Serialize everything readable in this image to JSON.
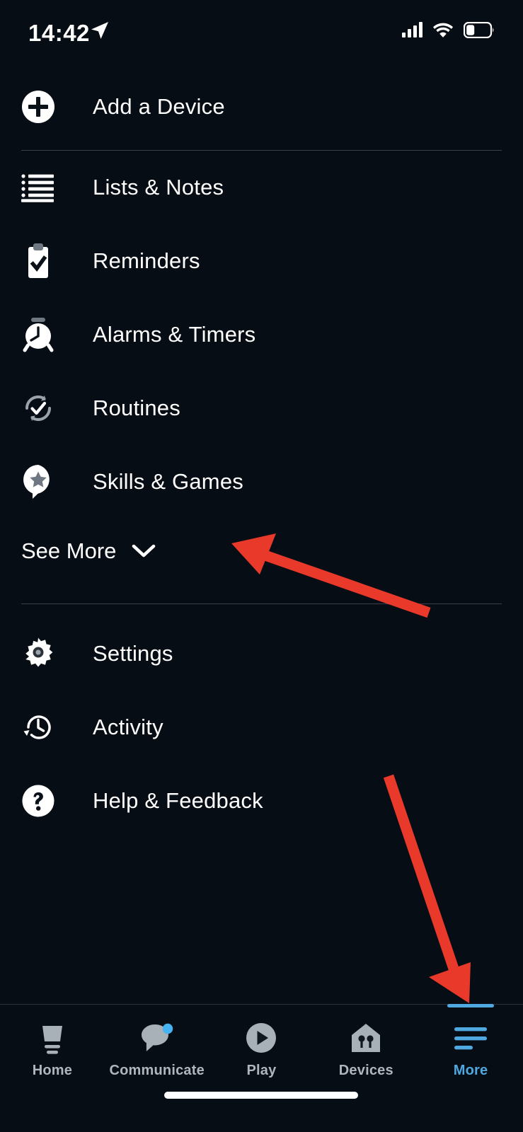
{
  "status_bar": {
    "time": "14:42",
    "location_icon": "location-arrow-icon",
    "signal_icon": "cellular-signal-icon",
    "wifi_icon": "wifi-icon",
    "battery_icon": "battery-low-icon"
  },
  "menu": {
    "add_device": {
      "label": "Add a Device",
      "icon": "plus-circle-icon"
    },
    "items": [
      {
        "label": "Lists & Notes",
        "icon": "list-icon"
      },
      {
        "label": "Reminders",
        "icon": "clipboard-check-icon"
      },
      {
        "label": "Alarms & Timers",
        "icon": "alarm-clock-icon"
      },
      {
        "label": "Routines",
        "icon": "routine-refresh-check-icon"
      },
      {
        "label": "Skills & Games",
        "icon": "star-bubble-icon"
      }
    ],
    "see_more": {
      "label": "See More",
      "icon": "chevron-down-icon"
    },
    "secondary_items": [
      {
        "label": "Settings",
        "icon": "gear-icon"
      },
      {
        "label": "Activity",
        "icon": "history-clock-icon"
      },
      {
        "label": "Help & Feedback",
        "icon": "question-circle-icon"
      }
    ]
  },
  "tab_bar": {
    "tabs": [
      {
        "label": "Home",
        "icon": "echo-device-icon",
        "active": false,
        "badge": false
      },
      {
        "label": "Communicate",
        "icon": "speech-bubble-icon",
        "active": false,
        "badge": true
      },
      {
        "label": "Play",
        "icon": "play-circle-icon",
        "active": false,
        "badge": false
      },
      {
        "label": "Devices",
        "icon": "home-devices-icon",
        "active": false,
        "badge": false
      },
      {
        "label": "More",
        "icon": "hamburger-icon",
        "active": true,
        "badge": false
      }
    ]
  },
  "annotations": {
    "arrow_color": "#E8392A",
    "arrows": [
      {
        "name": "arrow-to-skills-and-games",
        "points_at": "Skills & Games"
      },
      {
        "name": "arrow-to-more-tab",
        "points_at": "More"
      }
    ]
  },
  "colors": {
    "background": "#070D14",
    "text_primary": "#FFFFFF",
    "text_muted": "#AEB6BE",
    "accent_blue": "#4FA8E0",
    "divider": "#3A4048",
    "annotation_red": "#E8392A"
  }
}
